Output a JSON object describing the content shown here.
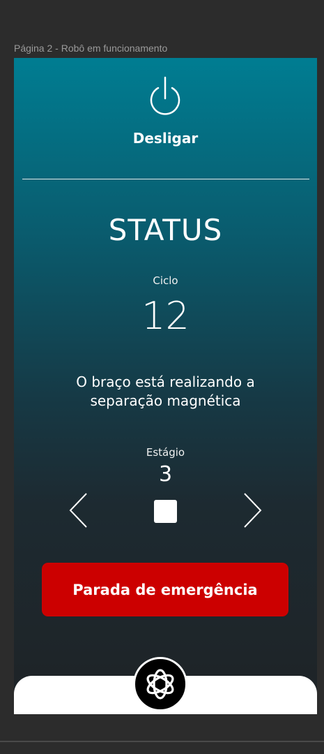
{
  "frame": {
    "label": "Página 2 - Robô em funcionamento"
  },
  "power": {
    "label": "Desligar",
    "icon": "power-icon"
  },
  "status": {
    "title": "STATUS",
    "cycle_label": "Ciclo",
    "cycle_value": "12",
    "message": "O braço está realizando a separação magnética",
    "stage_label": "Estágio",
    "stage_value": "3"
  },
  "controls": {
    "prev_icon": "chevron-left-icon",
    "stop_icon": "stop-icon",
    "next_icon": "chevron-right-icon"
  },
  "emergency": {
    "label": "Parada de emergência",
    "color": "#cc0000"
  },
  "colors": {
    "gradient_top": "#007d92",
    "gradient_bottom": "#1e2326",
    "page_bg": "#2c2c2c"
  }
}
